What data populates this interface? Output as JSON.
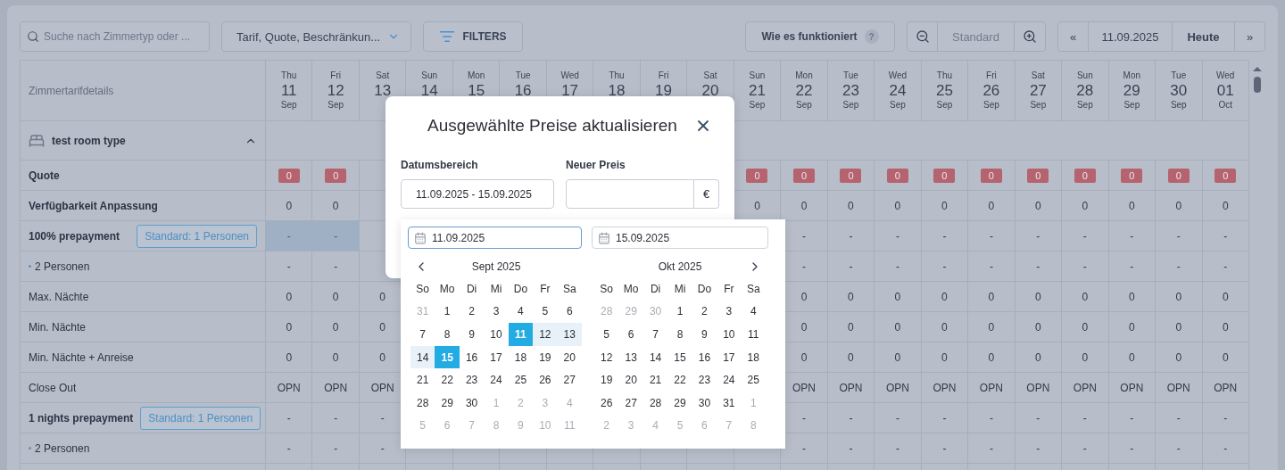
{
  "toolbar": {
    "search": {
      "placeholder": "Suche nach Zimmertyp oder ..."
    },
    "view_select": {
      "value": "Tarif, Quote, Beschränkun..."
    },
    "filters_button": {
      "label": "FILTERS"
    },
    "help_button": {
      "label": "Wie es funktioniert",
      "badge": "?"
    },
    "zoom": {
      "label": "Standard"
    },
    "date_nav": {
      "prev": "«",
      "date": "11.09.2025",
      "today": "Heute",
      "next": "»"
    }
  },
  "table": {
    "label_header": "Zimmertarifdetails",
    "dates": [
      {
        "day": "Thu",
        "number": "11",
        "month": "Sep"
      },
      {
        "day": "Fri",
        "number": "12",
        "month": "Sep"
      },
      {
        "day": "Sat",
        "number": "13"
      },
      {
        "day": "Sun",
        "number": "14"
      },
      {
        "day": "Mon",
        "number": "15"
      },
      {
        "day": "Tue",
        "number": "16"
      },
      {
        "day": "Wed",
        "number": "17"
      },
      {
        "day": "Thu",
        "number": "18"
      },
      {
        "day": "Fri",
        "number": "19"
      },
      {
        "day": "Sat",
        "number": "20"
      },
      {
        "day": "Sun",
        "number": "21",
        "month": "Sep"
      },
      {
        "day": "Mon",
        "number": "22",
        "month": "Sep"
      },
      {
        "day": "Tue",
        "number": "23",
        "month": "Sep"
      },
      {
        "day": "Wed",
        "number": "24",
        "month": "Sep"
      },
      {
        "day": "Thu",
        "number": "25",
        "month": "Sep"
      },
      {
        "day": "Fri",
        "number": "26",
        "month": "Sep"
      },
      {
        "day": "Sat",
        "number": "27",
        "month": "Sep"
      },
      {
        "day": "Sun",
        "number": "28",
        "month": "Sep"
      },
      {
        "day": "Mon",
        "number": "29",
        "month": "Sep"
      },
      {
        "day": "Tue",
        "number": "30",
        "month": "Sep"
      },
      {
        "day": "Wed",
        "number": "01",
        "month": "Oct"
      }
    ],
    "room_type": {
      "name": "test room type",
      "expanded": true
    },
    "rows": [
      {
        "kind": "quota",
        "label": "Quote",
        "cells_start": [
          "0",
          "0"
        ],
        "cells_end": [
          "0",
          "0",
          "0",
          "0",
          "0",
          "0",
          "0",
          "0",
          "0",
          "0",
          "0"
        ]
      },
      {
        "kind": "bold",
        "label": "Verfügbarkeit Anpassung",
        "cells_start": [
          "0",
          "0"
        ],
        "cells_end": [
          "0",
          "0",
          "0",
          "0",
          "0",
          "0",
          "0",
          "0",
          "0",
          "0",
          "0"
        ]
      },
      {
        "kind": "rate",
        "label": "100% prepayment",
        "badge": "Standard: 1 Personen",
        "range_selected": true,
        "cells_start": [
          "-",
          "-"
        ],
        "cells_end": [
          "-",
          "-",
          "-",
          "-",
          "-",
          "-",
          "-",
          "-",
          "-",
          "-"
        ]
      },
      {
        "kind": "sub",
        "label": "2 Personen",
        "cells_start": [
          "-",
          "-"
        ],
        "cells_end": [
          "-",
          "-",
          "-",
          "-",
          "-",
          "-",
          "-",
          "-",
          "-",
          "-"
        ]
      },
      {
        "kind": "plain",
        "label": "Max. Nächte",
        "cells_start": [
          "0",
          "0",
          "0"
        ],
        "cells_end": [
          "0",
          "0",
          "0",
          "0",
          "0",
          "0",
          "0",
          "0",
          "0",
          "0"
        ]
      },
      {
        "kind": "plain",
        "label": "Min. Nächte",
        "cells_start": [
          "0",
          "0",
          "0"
        ],
        "cells_end": [
          "0",
          "0",
          "0",
          "0",
          "0",
          "0",
          "0",
          "0",
          "0",
          "0"
        ]
      },
      {
        "kind": "plain",
        "label": "Min. Nächte + Anreise",
        "cells_start": [
          "0",
          "0",
          "0"
        ],
        "cells_end": [
          "0",
          "0",
          "0",
          "0",
          "0",
          "0",
          "0",
          "0",
          "0",
          "0"
        ]
      },
      {
        "kind": "plain",
        "label": "Close Out",
        "cells_start": [
          "OPN",
          "OPN",
          "OPN"
        ],
        "cells_end": [
          "OPN",
          "OPN",
          "OPN",
          "OPN",
          "OPN",
          "OPN",
          "OPN",
          "OPN",
          "OPN",
          "OPN"
        ]
      },
      {
        "kind": "rate",
        "label": "1 nights prepayment",
        "badge": "Standard: 1 Personen",
        "range_selected": false,
        "cells_start": [
          "-",
          "-",
          "-"
        ],
        "cells_end": [
          "-",
          "-",
          "-",
          "-",
          "-",
          "-",
          "-",
          "-",
          "-",
          "-"
        ]
      },
      {
        "kind": "sub",
        "label": "2 Personen",
        "cells_start": [
          "-",
          "-",
          "-"
        ],
        "cells_end": [
          "-",
          "-",
          "-",
          "-",
          "-",
          "-",
          "-",
          "-",
          "-",
          "-"
        ]
      }
    ]
  },
  "dialog": {
    "title": "Ausgewählte Preise aktualisieren",
    "date_range": {
      "label": "Datumsbereich",
      "value": "11.09.2025 - 15.09.2025"
    },
    "price": {
      "label": "Neuer Preis",
      "currency": "€"
    }
  },
  "datepicker": {
    "start": {
      "value": "11.09.2025",
      "focused": true
    },
    "end": {
      "value": "15.09.2025",
      "focused": false
    },
    "months": [
      {
        "title": "Sept 2025",
        "weekdays": [
          "So",
          "Mo",
          "Di",
          "Mi",
          "Do",
          "Fr",
          "Sa"
        ],
        "days": [
          {
            "label": "31",
            "outside": true,
            "selected": false,
            "in_range": false
          },
          {
            "label": "1",
            "outside": false,
            "selected": false,
            "in_range": false
          },
          {
            "label": "2",
            "outside": false,
            "selected": false,
            "in_range": false
          },
          {
            "label": "3",
            "outside": false,
            "selected": false,
            "in_range": false
          },
          {
            "label": "4",
            "outside": false,
            "selected": false,
            "in_range": false
          },
          {
            "label": "5",
            "outside": false,
            "selected": false,
            "in_range": false
          },
          {
            "label": "6",
            "outside": false,
            "selected": false,
            "in_range": false
          },
          {
            "label": "7",
            "outside": false,
            "selected": false,
            "in_range": false
          },
          {
            "label": "8",
            "outside": false,
            "selected": false,
            "in_range": false
          },
          {
            "label": "9",
            "outside": false,
            "selected": false,
            "in_range": false
          },
          {
            "label": "10",
            "outside": false,
            "selected": false,
            "in_range": false
          },
          {
            "label": "11",
            "outside": false,
            "selected": true,
            "in_range": false
          },
          {
            "label": "12",
            "outside": false,
            "selected": false,
            "in_range": true
          },
          {
            "label": "13",
            "outside": false,
            "selected": false,
            "in_range": true
          },
          {
            "label": "14",
            "outside": false,
            "selected": false,
            "in_range": true
          },
          {
            "label": "15",
            "outside": false,
            "selected": true,
            "in_range": false
          },
          {
            "label": "16",
            "outside": false,
            "selected": false,
            "in_range": false
          },
          {
            "label": "17",
            "outside": false,
            "selected": false,
            "in_range": false
          },
          {
            "label": "18",
            "outside": false,
            "selected": false,
            "in_range": false
          },
          {
            "label": "19",
            "outside": false,
            "selected": false,
            "in_range": false
          },
          {
            "label": "20",
            "outside": false,
            "selected": false,
            "in_range": false
          },
          {
            "label": "21",
            "outside": false,
            "selected": false,
            "in_range": false
          },
          {
            "label": "22",
            "outside": false,
            "selected": false,
            "in_range": false
          },
          {
            "label": "23",
            "outside": false,
            "selected": false,
            "in_range": false
          },
          {
            "label": "24",
            "outside": false,
            "selected": false,
            "in_range": false
          },
          {
            "label": "25",
            "outside": false,
            "selected": false,
            "in_range": false
          },
          {
            "label": "26",
            "outside": false,
            "selected": false,
            "in_range": false
          },
          {
            "label": "27",
            "outside": false,
            "selected": false,
            "in_range": false
          },
          {
            "label": "28",
            "outside": false,
            "selected": false,
            "in_range": false
          },
          {
            "label": "29",
            "outside": false,
            "selected": false,
            "in_range": false
          },
          {
            "label": "30",
            "outside": false,
            "selected": false,
            "in_range": false
          },
          {
            "label": "1",
            "outside": true,
            "selected": false,
            "in_range": false
          },
          {
            "label": "2",
            "outside": true,
            "selected": false,
            "in_range": false
          },
          {
            "label": "3",
            "outside": true,
            "selected": false,
            "in_range": false
          },
          {
            "label": "4",
            "outside": true,
            "selected": false,
            "in_range": false
          },
          {
            "label": "5",
            "outside": true,
            "selected": false,
            "in_range": false
          },
          {
            "label": "6",
            "outside": true,
            "selected": false,
            "in_range": false
          },
          {
            "label": "7",
            "outside": true,
            "selected": false,
            "in_range": false
          },
          {
            "label": "8",
            "outside": true,
            "selected": false,
            "in_range": false
          },
          {
            "label": "9",
            "outside": true,
            "selected": false,
            "in_range": false
          },
          {
            "label": "10",
            "outside": true,
            "selected": false,
            "in_range": false
          },
          {
            "label": "11",
            "outside": true,
            "selected": false,
            "in_range": false
          }
        ]
      },
      {
        "title": "Okt 2025",
        "weekdays": [
          "So",
          "Mo",
          "Di",
          "Mi",
          "Do",
          "Fr",
          "Sa"
        ],
        "days": [
          {
            "label": "28",
            "outside": true,
            "selected": false,
            "in_range": false
          },
          {
            "label": "29",
            "outside": true,
            "selected": false,
            "in_range": false
          },
          {
            "label": "30",
            "outside": true,
            "selected": false,
            "in_range": false
          },
          {
            "label": "1",
            "outside": false,
            "selected": false,
            "in_range": false
          },
          {
            "label": "2",
            "outside": false,
            "selected": false,
            "in_range": false
          },
          {
            "label": "3",
            "outside": false,
            "selected": false,
            "in_range": false
          },
          {
            "label": "4",
            "outside": false,
            "selected": false,
            "in_range": false
          },
          {
            "label": "5",
            "outside": false,
            "selected": false,
            "in_range": false
          },
          {
            "label": "6",
            "outside": false,
            "selected": false,
            "in_range": false
          },
          {
            "label": "7",
            "outside": false,
            "selected": false,
            "in_range": false
          },
          {
            "label": "8",
            "outside": false,
            "selected": false,
            "in_range": false
          },
          {
            "label": "9",
            "outside": false,
            "selected": false,
            "in_range": false
          },
          {
            "label": "10",
            "outside": false,
            "selected": false,
            "in_range": false
          },
          {
            "label": "11",
            "outside": false,
            "selected": false,
            "in_range": false
          },
          {
            "label": "12",
            "outside": false,
            "selected": false,
            "in_range": false
          },
          {
            "label": "13",
            "outside": false,
            "selected": false,
            "in_range": false
          },
          {
            "label": "14",
            "outside": false,
            "selected": false,
            "in_range": false
          },
          {
            "label": "15",
            "outside": false,
            "selected": false,
            "in_range": false
          },
          {
            "label": "16",
            "outside": false,
            "selected": false,
            "in_range": false
          },
          {
            "label": "17",
            "outside": false,
            "selected": false,
            "in_range": false
          },
          {
            "label": "18",
            "outside": false,
            "selected": false,
            "in_range": false
          },
          {
            "label": "19",
            "outside": false,
            "selected": false,
            "in_range": false
          },
          {
            "label": "20",
            "outside": false,
            "selected": false,
            "in_range": false
          },
          {
            "label": "21",
            "outside": false,
            "selected": false,
            "in_range": false
          },
          {
            "label": "22",
            "outside": false,
            "selected": false,
            "in_range": false
          },
          {
            "label": "23",
            "outside": false,
            "selected": false,
            "in_range": false
          },
          {
            "label": "24",
            "outside": false,
            "selected": false,
            "in_range": false
          },
          {
            "label": "25",
            "outside": false,
            "selected": false,
            "in_range": false
          },
          {
            "label": "26",
            "outside": false,
            "selected": false,
            "in_range": false
          },
          {
            "label": "27",
            "outside": false,
            "selected": false,
            "in_range": false
          },
          {
            "label": "28",
            "outside": false,
            "selected": false,
            "in_range": false
          },
          {
            "label": "29",
            "outside": false,
            "selected": false,
            "in_range": false
          },
          {
            "label": "30",
            "outside": false,
            "selected": false,
            "in_range": false
          },
          {
            "label": "31",
            "outside": false,
            "selected": false,
            "in_range": false
          },
          {
            "label": "1",
            "outside": true,
            "selected": false,
            "in_range": false
          },
          {
            "label": "2",
            "outside": true,
            "selected": false,
            "in_range": false
          },
          {
            "label": "3",
            "outside": true,
            "selected": false,
            "in_range": false
          },
          {
            "label": "4",
            "outside": true,
            "selected": false,
            "in_range": false
          },
          {
            "label": "5",
            "outside": true,
            "selected": false,
            "in_range": false
          },
          {
            "label": "6",
            "outside": true,
            "selected": false,
            "in_range": false
          },
          {
            "label": "7",
            "outside": true,
            "selected": false,
            "in_range": false
          },
          {
            "label": "8",
            "outside": true,
            "selected": false,
            "in_range": false
          }
        ]
      }
    ]
  }
}
